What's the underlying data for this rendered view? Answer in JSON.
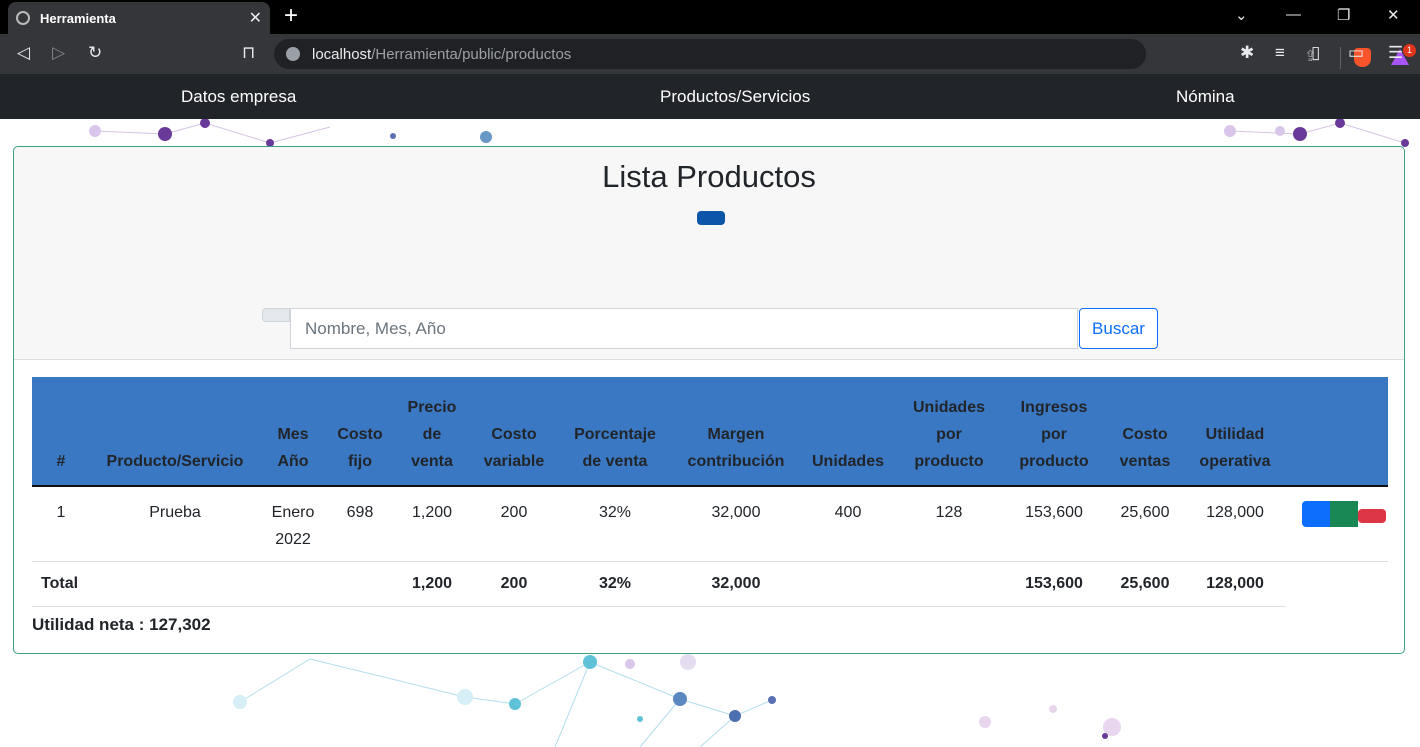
{
  "browser": {
    "tab_title": "Herramienta",
    "url_host": "localhost",
    "url_path": "/Herramienta/public/productos",
    "badge_count": "1"
  },
  "nav": {
    "items": [
      "Datos empresa",
      "Productos/Servicios",
      "Nómina"
    ]
  },
  "page": {
    "title": "Lista Productos",
    "search_placeholder": "Nombre, Mes, Año",
    "search_button": "Buscar"
  },
  "table": {
    "headers": [
      "#",
      "Producto/Servicio",
      "Mes Año",
      "Costo fijo",
      "Precio de venta",
      "Costo variable",
      "Porcentaje de venta",
      "Margen contribución",
      "Unidades",
      "Unidades por producto",
      "Ingresos por producto",
      "Costo ventas",
      "Utilidad operativa"
    ],
    "row": {
      "num": "1",
      "producto": "Prueba",
      "mes_anio": "Enero 2022",
      "costo_fijo": "698",
      "precio_venta": "1,200",
      "costo_variable": "200",
      "porcentaje": "32%",
      "margen": "32,000",
      "unidades": "400",
      "unidades_producto": "128",
      "ingresos": "153,600",
      "costo_ventas": "25,600",
      "utilidad": "128,000"
    },
    "total": {
      "label": "Total",
      "precio_venta": "1,200",
      "costo_variable": "200",
      "porcentaje": "32%",
      "margen": "32,000",
      "ingresos": "153,600",
      "costo_ventas": "25,600",
      "utilidad": "128,000"
    }
  },
  "summary": {
    "net_profit": "Utilidad neta : 127,302"
  },
  "colors": {
    "header_bg": "#3a78c3",
    "navbar_bg": "#212529",
    "primary": "#0d6efd",
    "success": "#198754",
    "danger": "#dc3545"
  }
}
